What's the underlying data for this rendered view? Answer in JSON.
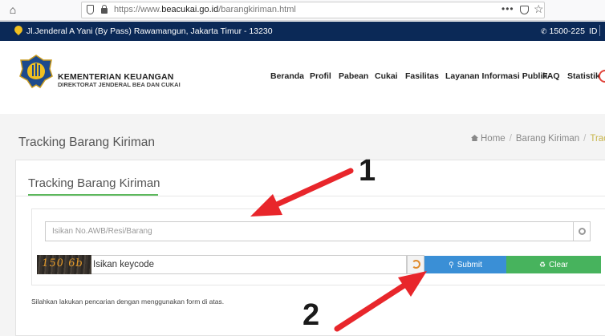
{
  "browser": {
    "url_prefix": "https://www.",
    "url_domain": "beacukai.go.id",
    "url_path": "/barangkiriman.html",
    "menu_dots": "•••"
  },
  "topbar": {
    "address": "Jl.Jenderal A Yani (By Pass) Rawamangun, Jakarta Timur - 13230",
    "phone": "1500-225",
    "lang": "ID",
    "bg_color": "#0b2957"
  },
  "header": {
    "brand_title": "KEMENTERIAN KEUANGAN",
    "brand_subtitle": "DIREKTORAT JENDERAL BEA DAN CUKAI",
    "nav": [
      "Beranda",
      "Profil",
      "Pabean",
      "Cukai",
      "Fasilitas",
      "Layanan Informasi Publik",
      "FAQ",
      "Statistik"
    ]
  },
  "page": {
    "title": "Tracking Barang Kiriman",
    "breadcrumb": [
      "Home",
      "Barang Kiriman",
      "Track"
    ]
  },
  "form": {
    "card_title": "Tracking Barang Kiriman",
    "awb_placeholder": "Isikan No.AWB/Resi/Barang",
    "captcha_text": "150 6b",
    "keycode_placeholder": "Isikan keycode",
    "submit_label": "Submit",
    "clear_label": "Clear",
    "info": "Silahkan lakukan pencarian dengan menggunakan form di atas.",
    "submit_color": "#3a8fd6",
    "clear_color": "#47b35d"
  },
  "annotations": {
    "label_1": "1",
    "label_2": "2",
    "arrow_color": "#e8262b"
  }
}
